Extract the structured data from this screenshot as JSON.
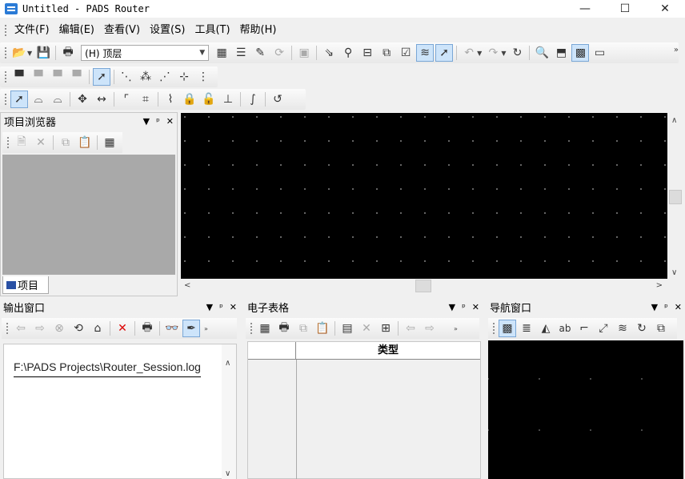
{
  "window": {
    "title": "Untitled - PADS Router",
    "minimize": "—",
    "maximize": "☐",
    "close": "✕"
  },
  "menu": [
    "文件(F)",
    "编辑(E)",
    "查看(V)",
    "设置(S)",
    "工具(T)",
    "帮助(H)"
  ],
  "toolbar": {
    "layer_selected": "(H) 顶层"
  },
  "project_browser": {
    "title": "项目浏览器",
    "tab_label": "项目"
  },
  "output_window": {
    "title": "输出窗口",
    "log_line": "F:\\PADS Projects\\Router_Session.log"
  },
  "spreadsheet": {
    "title": "电子表格",
    "column_type": "类型"
  },
  "navigator": {
    "title": "导航窗口"
  },
  "panel_controls": {
    "dropdown": "▼",
    "pin": "ᵖ",
    "close": "✕"
  },
  "icons": {
    "overflow": "»"
  }
}
